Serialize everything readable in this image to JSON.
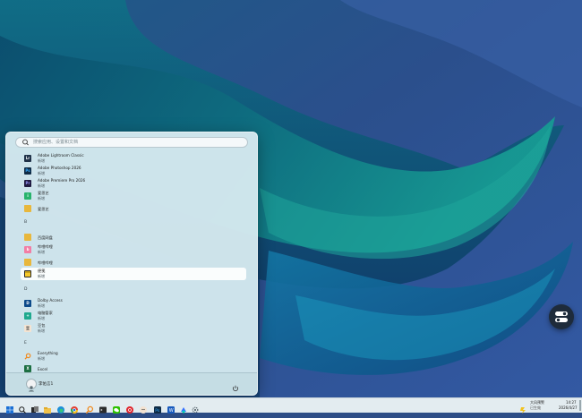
{
  "search": {
    "placeholder": "搜索应用、设置和文档"
  },
  "apps": [
    {
      "name": "Adobe Lightroom Classic",
      "tag": "新增",
      "icon": "lightroom-icon",
      "color": "#1f3148",
      "glyph": "Lr"
    },
    {
      "name": "Adobe Photoshop 2026",
      "tag": "新增",
      "icon": "photoshop-icon",
      "color": "#0f2b45",
      "glyph": "Ps"
    },
    {
      "name": "Adobe Premiere Pro 2026",
      "tag": "新增",
      "icon": "premiere-icon",
      "color": "#1f1a40",
      "glyph": "Pr"
    },
    {
      "name": "爱思艺",
      "tag": "新增",
      "icon": "aisiyi-icon",
      "color": "#27b36b",
      "glyph": "i"
    },
    {
      "name": "爱思艺",
      "tag": "",
      "icon": "folder-icon",
      "color": "#e8b73c",
      "glyph": ""
    },
    {
      "name": "百度网盘",
      "tag": "",
      "icon": "folder-icon",
      "color": "#e8b73c",
      "glyph": ""
    },
    {
      "name": "哔哩哔哩",
      "tag": "新增",
      "icon": "bilibili-icon",
      "color": "#f27ea5",
      "glyph": "b"
    },
    {
      "name": "哔哩哔哩",
      "tag": "",
      "icon": "folder-icon",
      "color": "#e8b73c",
      "glyph": ""
    },
    {
      "name": "便笺",
      "tag": "新增",
      "icon": "sticky-notes-icon",
      "color": "#2b2b2b",
      "glyph": ""
    },
    {
      "name": "Dolby Access",
      "tag": "新增",
      "icon": "dolby-icon",
      "color": "#0c4a8a",
      "glyph": "D"
    },
    {
      "name": "电脑管家",
      "tag": "新增",
      "icon": "pc-manager-icon",
      "color": "#1fa98e",
      "glyph": "+"
    },
    {
      "name": "豆包",
      "tag": "新增",
      "icon": "doubao-icon",
      "color": "#f3e3d2",
      "glyph": "豆"
    },
    {
      "name": "Everything",
      "tag": "新增",
      "icon": "everything-icon",
      "color": "#f08a1e",
      "glyph": ""
    },
    {
      "name": "Excel",
      "tag": "",
      "icon": "excel-icon",
      "color": "#1d6f42",
      "glyph": "X"
    }
  ],
  "letters": {
    "b": "B",
    "d": "D",
    "e": "E"
  },
  "footer": {
    "user_name": "李佑言1"
  },
  "weather": {
    "temp": "大风预警",
    "desc": "已生效"
  },
  "clock": {
    "time": "14:27",
    "date": "2026/4/27"
  }
}
